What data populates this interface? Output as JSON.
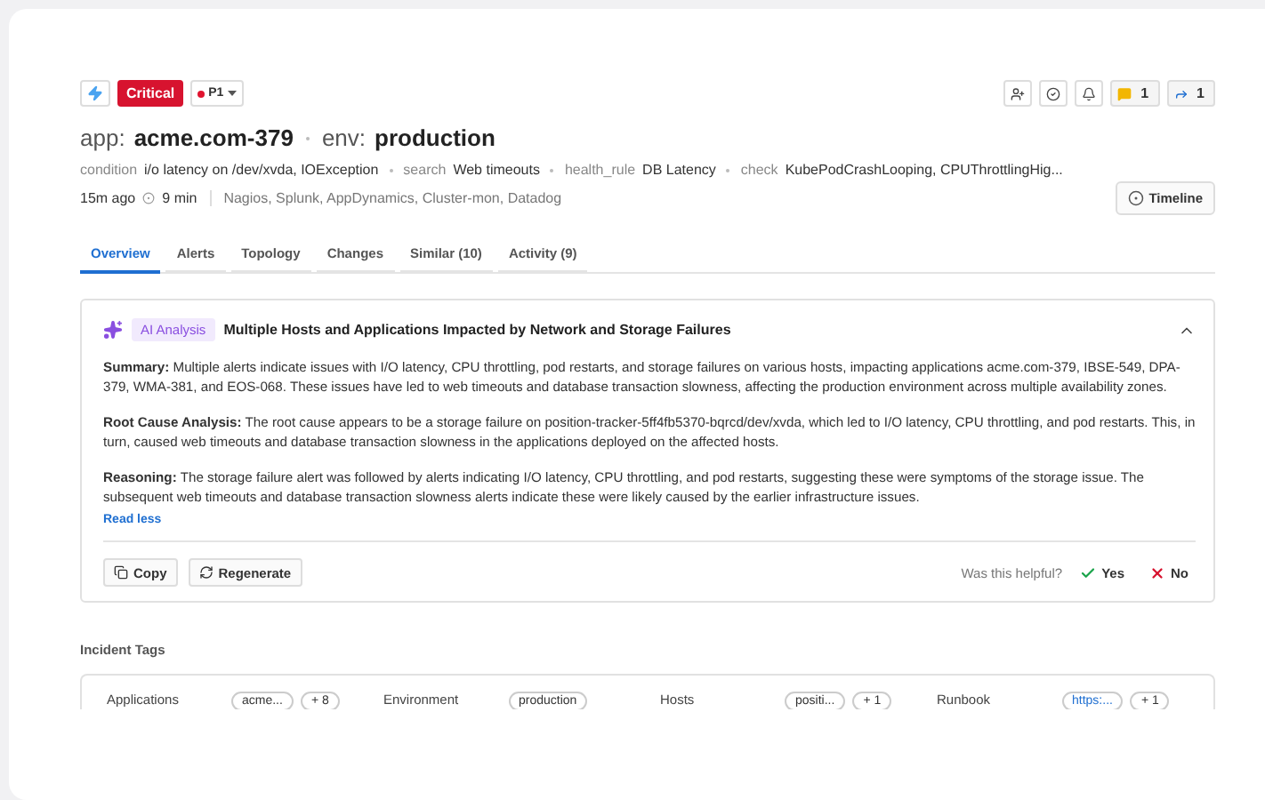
{
  "header": {
    "severity": "Critical",
    "priority": "P1",
    "actions": [
      {
        "kind": "assign"
      },
      {
        "kind": "resolve"
      },
      {
        "kind": "bell"
      },
      {
        "kind": "comment",
        "count": "1"
      },
      {
        "kind": "share",
        "count": "1"
      }
    ]
  },
  "title": [
    {
      "key": "app:",
      "value": "acme.com-379"
    },
    {
      "key": "env:",
      "value": "production"
    }
  ],
  "conditions": [
    {
      "label": "condition",
      "value": "i/o latency on /dev/xvda, IOException"
    },
    {
      "label": "search",
      "value": "Web timeouts"
    },
    {
      "label": "health_rule",
      "value": "DB Latency"
    },
    {
      "label": "check",
      "value": "KubePodCrashLooping, CPUThrottlingHig..."
    }
  ],
  "meta": {
    "age": "15m ago",
    "duration": "9 min",
    "sources": "Nagios, Splunk, AppDynamics, Cluster-mon, Datadog"
  },
  "timeline_button": "Timeline",
  "tabs": [
    {
      "label": "Overview",
      "selected": true
    },
    {
      "label": "Alerts",
      "selected": false
    },
    {
      "label": "Topology",
      "selected": false
    },
    {
      "label": "Changes",
      "selected": false
    },
    {
      "label": "Similar (10)",
      "selected": false
    },
    {
      "label": "Activity (9)",
      "selected": false
    }
  ],
  "ai_analysis": {
    "badge": "AI Analysis",
    "title": "Multiple Hosts and Applications Impacted by Network and Storage Failures",
    "sections": [
      {
        "text": "**Summary:** Multiple alerts indicate issues with I/O latency, CPU throttling, pod restarts, and storage failures on various hosts, impacting applications acme.com-379, IBSE-549, DPA-379, WMA-381, and EOS-068. These issues have led to web timeouts and database transaction slowness, affecting the production environment across multiple availability zones."
      },
      {
        "text": "**Root Cause Analysis:** The root cause appears to be a storage failure on position-tracker-5ff4fb5370-bqrcd/dev/xvda, which led to I/O latency, CPU throttling, and pod restarts. This, in turn, caused web timeouts and database transaction slowness in the applications deployed on the affected hosts."
      },
      {
        "text": "**Reasoning:** The storage failure alert was followed by alerts indicating I/O latency, CPU throttling, and pod restarts, suggesting these were symptoms of the storage issue. The subsequent web timeouts and database transaction slowness alerts indicate these were likely caused by the earlier infrastructure issues."
      }
    ],
    "read_less": "Read less",
    "copy": "Copy",
    "regenerate": "Regenerate",
    "feedback_prompt": "Was this helpful?",
    "yes": "Yes",
    "no": "No"
  },
  "incident_tags": {
    "title": "Incident Tags",
    "tags": [
      {
        "label": "Applications",
        "value": "acme...",
        "more": "+ 8",
        "kind": "text"
      },
      {
        "label": "Environment",
        "value": "production",
        "kind": "text"
      },
      {
        "label": "Hosts",
        "value": "positi...",
        "more": "+ 1",
        "kind": "text"
      },
      {
        "label": "Runbook",
        "value": "https:...",
        "more": "+ 1",
        "kind": "link"
      }
    ]
  }
}
